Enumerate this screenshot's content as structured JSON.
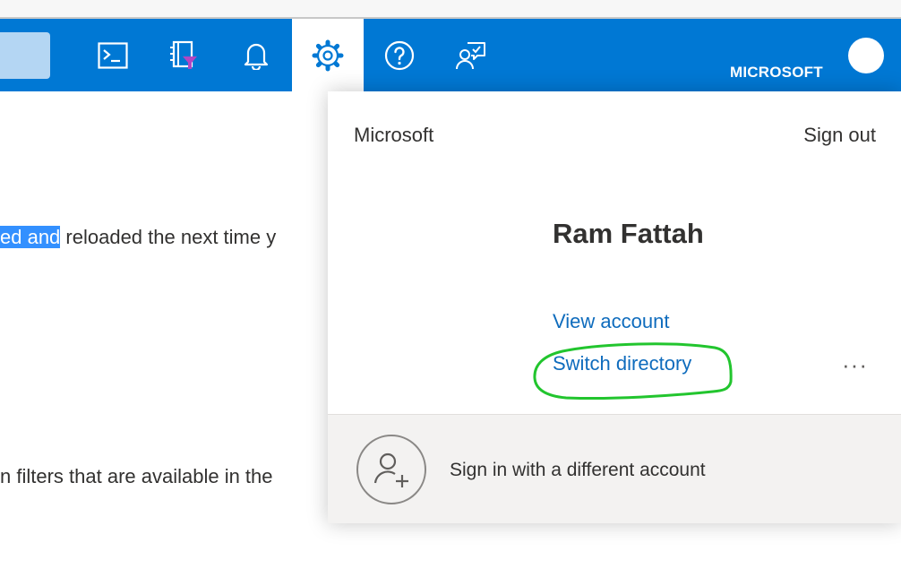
{
  "topbar": {
    "account_label": "MICROSOFT",
    "icons": [
      "cloud-shell-icon",
      "directory-filter-icon",
      "notifications-icon",
      "settings-icon",
      "help-icon",
      "feedback-icon"
    ],
    "accent_color": "#0078d4"
  },
  "background_text": {
    "line1_highlight": "ed and",
    "line1_rest": " reloaded the next time y",
    "line2": "n filters that are available in the"
  },
  "account_panel": {
    "tenant": "Microsoft",
    "sign_out": "Sign out",
    "user_name": "Ram Fattah",
    "view_account": "View account",
    "switch_directory": "Switch directory",
    "more": "···",
    "sign_in_other": "Sign in with a different account",
    "link_color": "#0f6cbd",
    "annotation_color": "#22c52e"
  }
}
